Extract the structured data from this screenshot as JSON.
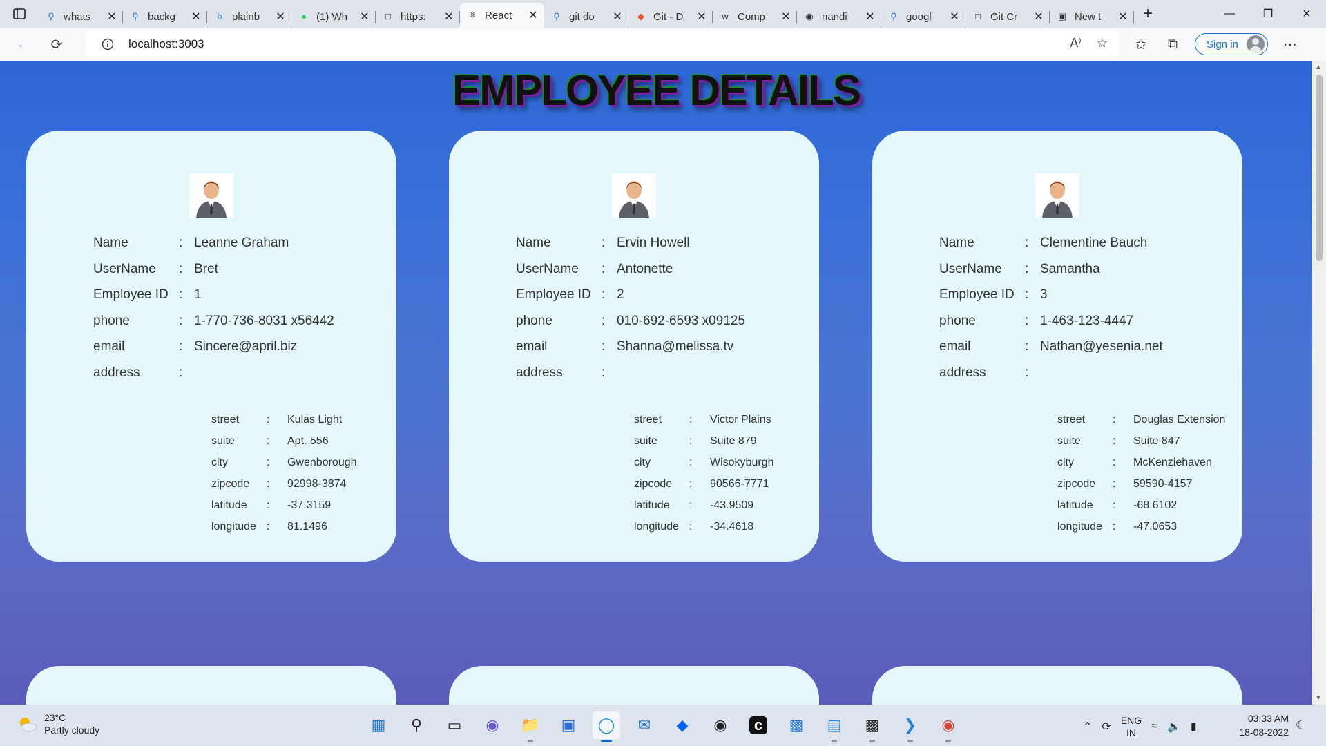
{
  "browser": {
    "tabs": [
      {
        "title": "whats",
        "icon": "search-icon"
      },
      {
        "title": "backg",
        "icon": "search-icon"
      },
      {
        "title": "plainb",
        "icon": "bing-icon"
      },
      {
        "title": "(1) Wh",
        "icon": "whatsapp-icon"
      },
      {
        "title": "https:",
        "icon": "page-icon"
      },
      {
        "title": "React",
        "icon": "react-icon",
        "active": true
      },
      {
        "title": "git do",
        "icon": "search-icon"
      },
      {
        "title": "Git - D",
        "icon": "git-icon"
      },
      {
        "title": "Comp",
        "icon": "w3-icon"
      },
      {
        "title": "nandi",
        "icon": "github-icon"
      },
      {
        "title": "googl",
        "icon": "search-icon"
      },
      {
        "title": "Git Cr",
        "icon": "doc-icon"
      },
      {
        "title": "New t",
        "icon": "newtab-icon"
      }
    ],
    "url": "localhost:3003",
    "signin_label": "Sign in"
  },
  "page": {
    "heading": "EMPLOYEE DETAILS",
    "labels": {
      "name": "Name",
      "username": "UserName",
      "id": "Employee ID",
      "phone": "phone",
      "email": "email",
      "address": "address",
      "street": "street",
      "suite": "suite",
      "city": "city",
      "zipcode": "zipcode",
      "latitude": "latitude",
      "longitude": "longitude",
      "sep": ":"
    },
    "employees": [
      {
        "name": "Leanne Graham",
        "username": "Bret",
        "id": "1",
        "phone": "1-770-736-8031 x56442",
        "email": "Sincere@april.biz",
        "street": "Kulas Light",
        "suite": "Apt. 556",
        "city": "Gwenborough",
        "zipcode": "92998-3874",
        "lat": "-37.3159",
        "lng": "81.1496"
      },
      {
        "name": "Ervin Howell",
        "username": "Antonette",
        "id": "2",
        "phone": "010-692-6593 x09125",
        "email": "Shanna@melissa.tv",
        "street": "Victor Plains",
        "suite": "Suite 879",
        "city": "Wisokyburgh",
        "zipcode": "90566-7771",
        "lat": "-43.9509",
        "lng": "-34.4618"
      },
      {
        "name": "Clementine Bauch",
        "username": "Samantha",
        "id": "3",
        "phone": "1-463-123-4447",
        "email": "Nathan@yesenia.net",
        "street": "Douglas Extension",
        "suite": "Suite 847",
        "city": "McKenziehaven",
        "zipcode": "59590-4157",
        "lat": "-68.6102",
        "lng": "-47.0653"
      }
    ]
  },
  "taskbar": {
    "weather_temp": "23°C",
    "weather_desc": "Partly cloudy",
    "lang_top": "ENG",
    "lang_bottom": "IN",
    "time": "03:33 AM",
    "date": "18-08-2022",
    "apps": [
      "start-icon",
      "search-icon",
      "task-view-icon",
      "chat-icon",
      "file-explorer-icon",
      "store-icon",
      "edge-icon",
      "mail-icon",
      "dropbox-icon",
      "github-desktop-icon",
      "terminal-dark-icon",
      "control-panel-icon",
      "notepad-icon",
      "cmd-icon",
      "vscode-icon",
      "chrome-icon"
    ]
  }
}
